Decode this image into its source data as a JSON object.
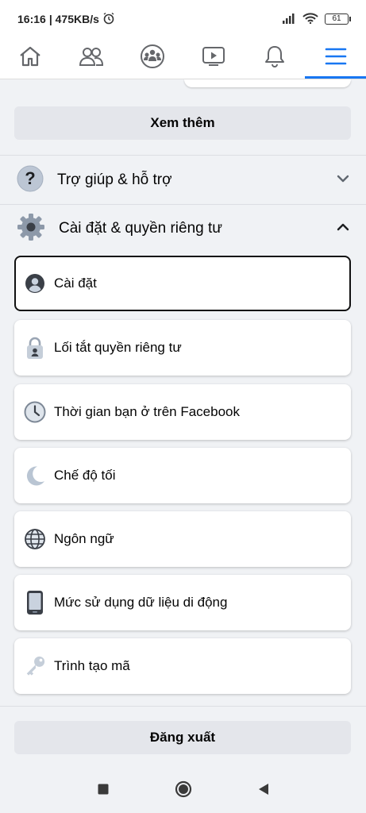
{
  "status_bar": {
    "time": "16:16",
    "speed": "| 475KB/s",
    "battery": "61"
  },
  "tabs": [
    {
      "name": "home-icon",
      "active": false
    },
    {
      "name": "friends-icon",
      "active": false
    },
    {
      "name": "groups-icon",
      "active": false
    },
    {
      "name": "watch-icon",
      "active": false
    },
    {
      "name": "bell-icon",
      "active": false
    },
    {
      "name": "menu-icon",
      "active": true
    }
  ],
  "menu": {
    "see_more": "Xem thêm",
    "help_section": {
      "label": "Trợ giúp & hỗ trợ",
      "icon": "question-icon",
      "expanded": false
    },
    "settings_section": {
      "label": "Cài đặt & quyền riêng tư",
      "icon": "gear-icon",
      "expanded": true
    },
    "items": [
      {
        "label": "Cài đặt",
        "icon": "profile-settings-icon"
      },
      {
        "label": "Lối tắt quyền riêng tư",
        "icon": "privacy-lock-icon"
      },
      {
        "label": "Thời gian bạn ở trên Facebook",
        "icon": "clock-icon"
      },
      {
        "label": "Chế độ tối",
        "icon": "moon-icon"
      },
      {
        "label": "Ngôn ngữ",
        "icon": "globe-icon"
      },
      {
        "label": "Mức sử dụng dữ liệu di động",
        "icon": "phone-icon"
      },
      {
        "label": "Trình tạo mã",
        "icon": "key-icon"
      }
    ],
    "logout": "Đăng xuất"
  },
  "colors": {
    "accent": "#1877f2",
    "background": "#f0f2f5",
    "card": "#ffffff",
    "gray_button": "#e4e6eb"
  }
}
